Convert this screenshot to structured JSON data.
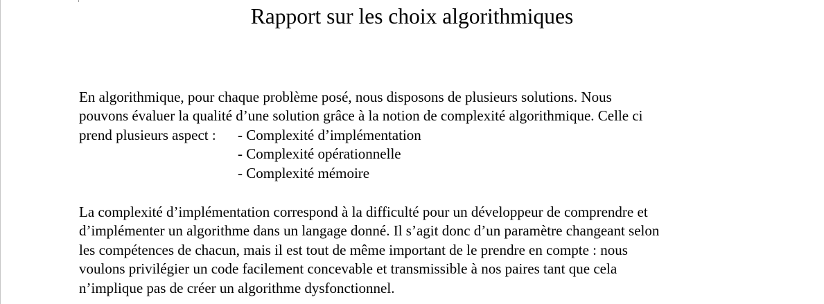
{
  "document": {
    "title": "Rapport sur les choix algorithmiques",
    "intro": {
      "lines": [
        "En algorithmique, pour chaque problème posé, nous disposons de plusieurs solutions. Nous",
        "pouvons évaluer la qualité d’une solution grâce à la notion de complexité algorithmique. Celle ci"
      ],
      "list_lead": "prend plusieurs aspect :",
      "list_items": [
        "- Complexité d’implémentation",
        "- Complexité opérationnelle",
        "- Complexité mémoire"
      ]
    },
    "implementation_paragraph": {
      "lines": [
        "La complexité d’implémentation correspond à la difficulté pour un développeur de comprendre et",
        "d’implémenter un algorithme dans un langage donné. Il s’agit donc d’un paramètre changeant selon",
        "les compétences de chacun, mais il est tout de même important de le prendre en compte : nous",
        "voulons privilégier un code facilement concevable et transmissible à nos paires tant que cela",
        "n’implique pas de créer un algorithme dysfonctionnel."
      ]
    }
  }
}
